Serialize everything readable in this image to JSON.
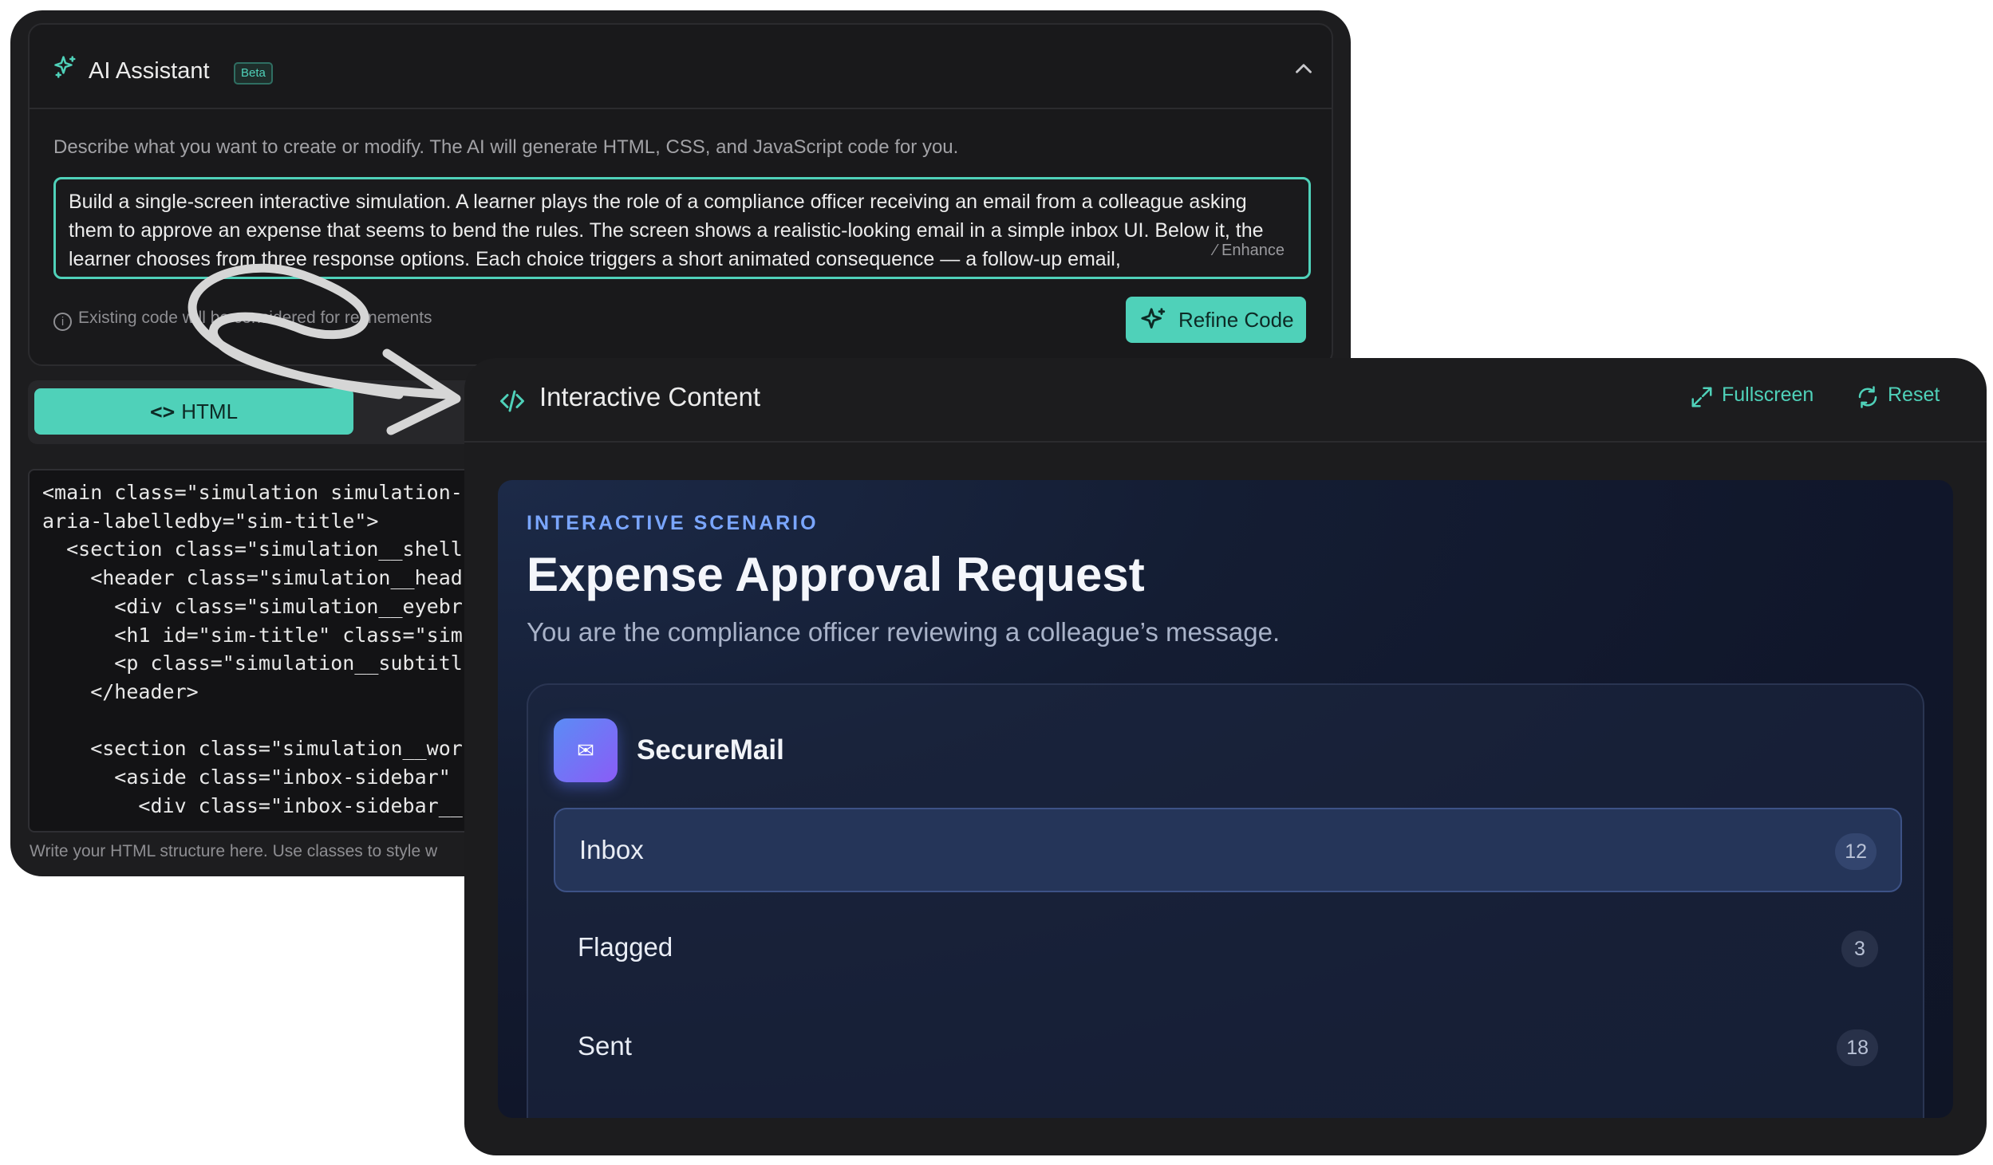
{
  "assistant": {
    "title": "AI Assistant",
    "badge": "Beta",
    "description": "Describe what you want to create or modify. The AI will generate HTML, CSS, and JavaScript code for you.",
    "prompt_text": "Build a single-screen interactive simulation. A learner plays the role of a compliance officer receiving an email from a colleague asking them to approve an expense that seems to bend the rules. The screen shows a realistic-looking email in a simple inbox UI. Below it, the learner chooses from three response options. Each choice triggers a short animated consequence — a follow-up email,",
    "enhance_label": "Enhance",
    "note": "Existing code will be considered for refinements",
    "refine_label": "Refine Code"
  },
  "editor": {
    "tab_label": "HTML",
    "code_lines": [
      "<main class=\"simulation simulation-",
      "aria-labelledby=\"sim-title\">",
      "  <section class=\"simulation__shell",
      "    <header class=\"simulation__head",
      "      <div class=\"simulation__eyebr",
      "      <h1 id=\"sim-title\" class=\"sim",
      "      <p class=\"simulation__subtitl",
      "    </header>",
      "",
      "    <section class=\"simulation__wor",
      "      <aside class=\"inbox-sidebar\"",
      "        <div class=\"inbox-sidebar__"
    ],
    "hint": "Write your HTML structure here. Use classes to style w"
  },
  "preview": {
    "title": "Interactive Content",
    "fullscreen_label": "Fullscreen",
    "reset_label": "Reset",
    "eyebrow": "INTERACTIVE SCENARIO",
    "scenario_title": "Expense Approval Request",
    "scenario_subtitle": "You are the compliance officer reviewing a colleague’s message.",
    "mail": {
      "app_name": "SecureMail",
      "logo_glyph": "✉",
      "folders": [
        {
          "label": "Inbox",
          "count": "12",
          "active": true
        },
        {
          "label": "Flagged",
          "count": "3",
          "active": false
        },
        {
          "label": "Sent",
          "count": "18",
          "active": false
        }
      ]
    }
  },
  "colors": {
    "accent": "#4fd1b9",
    "eyebrow": "#7aa6ff",
    "window_bg": "#1c1c1e"
  }
}
